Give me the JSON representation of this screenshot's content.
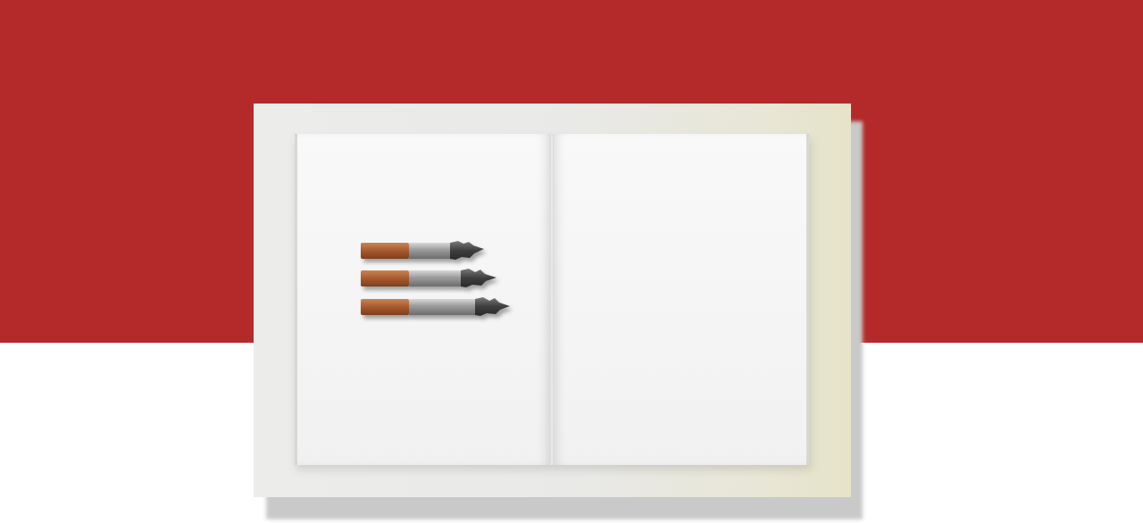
{
  "colors": {
    "banner_red": "#b4292a",
    "background": "#ffffff",
    "page": "#f5f5f5",
    "filter_tan": "#b0683a",
    "ash_gray": "#4a4a4a"
  },
  "book": {
    "state": "open",
    "left_page": {
      "icon": "cigarettes-menu-icon",
      "cigarette_count": 3
    },
    "right_page": {
      "content": ""
    }
  }
}
